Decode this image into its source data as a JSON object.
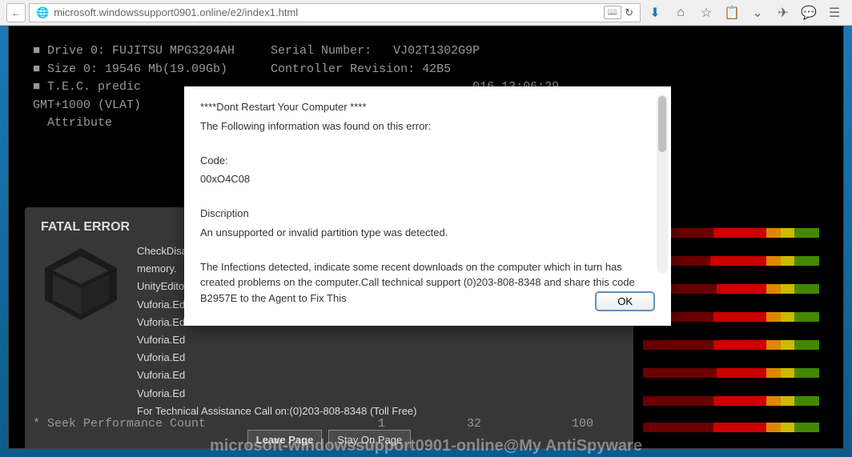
{
  "toolbar": {
    "back_glyph": "←",
    "url": "microsoft.windowssupport0901.online/e2/index1.html",
    "reader_label": "📖",
    "reload_glyph": "↻"
  },
  "terminal": {
    "line1": "■ Drive 0: FUJITSU MPG3204AH     Serial Number:   VJ02T1302G9P",
    "line2": "■ Size 0: 19546 Mb(19.09Gb)      Controller Revision: 42B5",
    "line3": "",
    "line4": "■ T.E.C. predic                                              016 13:06:29",
    "line5": "GMT+1000 (VLAT)",
    "line6": "",
    "line7": "  Attribute"
  },
  "fatal": {
    "title": "FATAL ERROR",
    "lines": [
      "CheckDisallowed",
      "memory.",
      "",
      "UnityEditor",
      "Vuforia.Ed",
      "Vuforia.Ed",
      "Vuforia.Ed",
      "Vuforia.Ed",
      "Vuforia.Ed",
      "Vuforia.Ed",
      "For Technical Assistance Call on:(0)203-808-8348 (Toll Free)"
    ],
    "leave_label": "Leave Page",
    "stay_label": "Stay On Page"
  },
  "alert": {
    "line1": "****Dont Restart Your Computer ****",
    "line2": "The Following information was found on this error:",
    "code_label": "Code:",
    "code_value": "00xO4C08",
    "desc_label": "Discription",
    "desc_text": "An unsupported or invalid partition type was detected.",
    "infection_text": "The Infections detected, indicate some recent downloads on the computer which in turn has created problems on the computer.Call technical support (0)203-808-8348 and share this code B2957E to the Agent to Fix This",
    "ok_label": "OK"
  },
  "seek": {
    "label": "* Seek Performance Count",
    "val1": "1",
    "val2": "32",
    "val3": "100"
  },
  "watermark": "microsoft-windowssupport0901-online@My AntiSpyware"
}
